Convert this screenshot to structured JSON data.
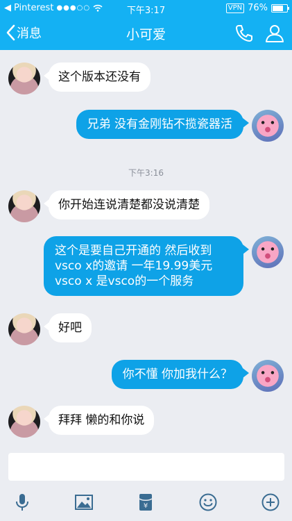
{
  "status_bar": {
    "carrier": "Pinterest",
    "signal_dots": "●●●○○",
    "time": "下午3:17",
    "vpn": "VPN",
    "battery": "76%",
    "battery_level": 0.76
  },
  "nav": {
    "back_label": "消息",
    "title": "小可爱"
  },
  "messages": [
    {
      "from": "them",
      "text": "这个版本还没有"
    },
    {
      "from": "me",
      "text": "兄弟 没有金刚钻不揽瓷器活"
    },
    {
      "timestamp": "下午3:16"
    },
    {
      "from": "them",
      "text": "你开始连说清楚都没说清楚"
    },
    {
      "from": "me",
      "text": "这个是要自己开通的 然后收到vsco x的邀请 一年19.99美元 vsco x 是vsco的一个服务"
    },
    {
      "from": "them",
      "text": "好吧"
    },
    {
      "from": "me",
      "text": "你不懂 你加我什么？"
    },
    {
      "from": "them",
      "text": "拜拜 懒的和你说"
    }
  ],
  "input": {
    "value": "",
    "placeholder": ""
  },
  "toolbar": {
    "icons": [
      "microphone-icon",
      "image-icon",
      "red-packet-icon",
      "emoji-icon",
      "plus-icon"
    ]
  },
  "colors": {
    "header": "#14b1f3",
    "outgoing_bubble": "#0ea2e7",
    "incoming_bubble": "#ffffff",
    "background": "#ebedf2",
    "icon": "#3a6c92"
  }
}
